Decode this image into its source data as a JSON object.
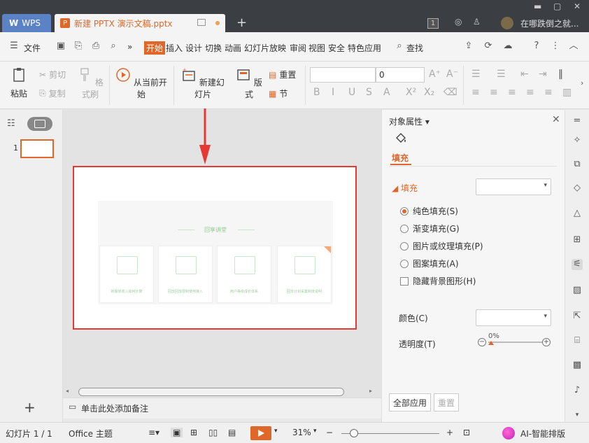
{
  "titlebar": {
    "app_tab": "WPS",
    "doc_tab": "新建 PPTX 演示文稿.pptx",
    "new_tab": "+",
    "badge": "1",
    "user_name": "在哪跌倒之就..."
  },
  "menubar": {
    "file": "文件",
    "more": "»",
    "tabs": [
      "开始",
      "插入",
      "设计",
      "切换",
      "动画",
      "幻灯片放映",
      "审阅",
      "视图",
      "安全",
      "特色应用"
    ],
    "search": "查找"
  },
  "ribbon": {
    "paste": "粘贴",
    "cut": "剪切",
    "copy": "复制",
    "format_painter": "格式刷",
    "from_current": "从当前开始",
    "new_slide": "新建幻灯片",
    "layout": "版式",
    "reset": "重置",
    "section": "节",
    "font_size": "0"
  },
  "thumbnails": {
    "slide_number": "1"
  },
  "slide": {
    "title": "回享讲堂",
    "cards": [
      "新服单收入如何计算",
      "回放回放限制使用接入",
      "用户等级成长体系",
      "回享计划采集制度说明"
    ]
  },
  "notes": {
    "placeholder": "单击此处添加备注"
  },
  "props": {
    "title": "对象属性",
    "tab_fill": "填充",
    "section_fill": "填充",
    "options": [
      "纯色填充(S)",
      "渐变填充(G)",
      "图片或纹理填充(P)",
      "图案填充(A)"
    ],
    "hide_bg": "隐藏背景图形(H)",
    "color_label": "颜色(C)",
    "transparency_label": "透明度(T)",
    "transparency_value": "0%",
    "apply_all": "全部应用",
    "reset": "重置"
  },
  "statusbar": {
    "slide_info": "幻灯片 1 / 1",
    "theme": "Office 主题",
    "zoom": "31%",
    "ai": "AI-智能排版"
  },
  "colors": {
    "accent": "#e0672a",
    "titlebar": "#3b3e43",
    "wps_tab": "#5a82c5",
    "highlight_border": "#e53935"
  }
}
